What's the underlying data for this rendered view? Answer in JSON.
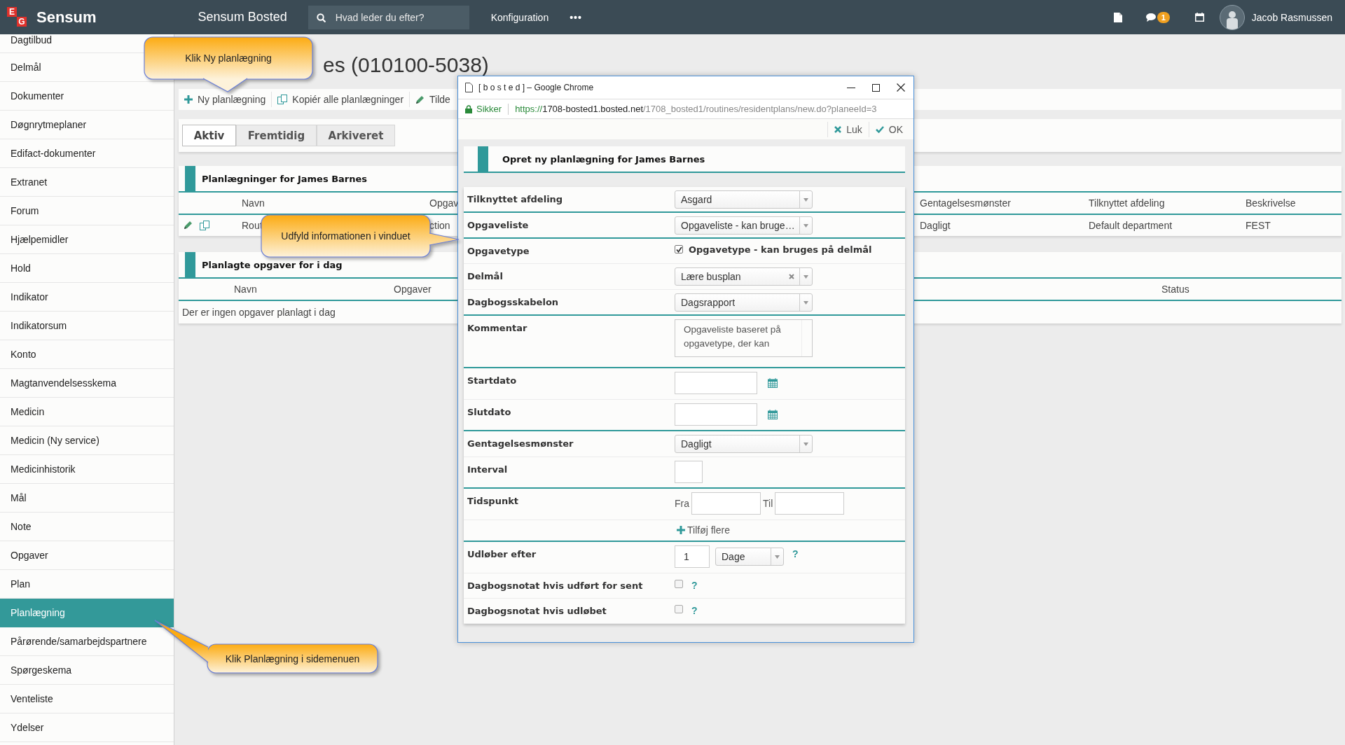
{
  "topbar": {
    "logo": [
      "E",
      "G"
    ],
    "brand": "Sensum",
    "app_name": "Sensum Bosted",
    "search": {
      "placeholder": "Hvad leder du efter?"
    },
    "menu": "Konfiguration",
    "more": "•••",
    "notifications": "1",
    "user": "Jacob Rasmussen"
  },
  "sidebar": {
    "items": [
      {
        "label": "Dagtilbud",
        "selected": false
      },
      {
        "label": "Delmål",
        "selected": false
      },
      {
        "label": "Dokumenter",
        "selected": false
      },
      {
        "label": "Døgnrytmeplaner",
        "selected": false
      },
      {
        "label": "Edifact-dokumenter",
        "selected": false
      },
      {
        "label": "Extranet",
        "selected": false
      },
      {
        "label": "Forum",
        "selected": false
      },
      {
        "label": "Hjælpemidler",
        "selected": false
      },
      {
        "label": "Hold",
        "selected": false
      },
      {
        "label": "Indikator",
        "selected": false
      },
      {
        "label": "Indikatorsum",
        "selected": false
      },
      {
        "label": "Konto",
        "selected": false
      },
      {
        "label": "Magtanvendelsesskema",
        "selected": false
      },
      {
        "label": "Medicin",
        "selected": false
      },
      {
        "label": "Medicin (Ny service)",
        "selected": false
      },
      {
        "label": "Medicinhistorik",
        "selected": false
      },
      {
        "label": "Mål",
        "selected": false
      },
      {
        "label": "Note",
        "selected": false
      },
      {
        "label": "Opgaver",
        "selected": false
      },
      {
        "label": "Plan",
        "selected": false
      },
      {
        "label": "Planlægning",
        "selected": true
      },
      {
        "label": "Pårørende/samarbejdspartnere",
        "selected": false
      },
      {
        "label": "Spørgeskema",
        "selected": false
      },
      {
        "label": "Venteliste",
        "selected": false
      },
      {
        "label": "Ydelser",
        "selected": false
      }
    ]
  },
  "page": {
    "title": "es (010100-5038)",
    "toolbar": [
      "Ny planlægning",
      "Kopiér alle planlægninger",
      "Tilde"
    ],
    "tabs": [
      {
        "label": "Aktiv",
        "selected": true
      },
      {
        "label": "Fremtidig",
        "selected": false
      },
      {
        "label": "Arkiveret",
        "selected": false
      }
    ],
    "plans": {
      "title": "Planlægninger for James Barnes",
      "columns": [
        "Navn",
        "Opgav",
        "Gentagelsesmønster",
        "Tilknyttet afdeling",
        "Beskrivelse"
      ],
      "rows": [
        {
          "cells": [
            "Rout",
            "ction",
            "Dagligt",
            "Default department",
            "FEST"
          ]
        }
      ]
    },
    "today": {
      "title": "Planlagte opgaver for i dag",
      "columns": [
        "Navn",
        "Opgaver",
        "Status"
      ],
      "empty": "Der er ingen opgaver planlagt i dag"
    }
  },
  "dialog": {
    "window_title": "[ b o s t e d ] – Google Chrome",
    "secure_label": "Sikker",
    "url": {
      "scheme": "https://",
      "host": "1708-bosted1.bosted.net",
      "path": "/1708_bosted1/routines/residentplans/new.do?planeeId=3"
    },
    "actions": [
      "Luk",
      "OK"
    ],
    "heading": "Opret ny planlægning for James Barnes",
    "fields": [
      {
        "kind": "select",
        "label": "Tilknyttet afdeling",
        "value": "Asgard",
        "group_end": true
      },
      {
        "kind": "select",
        "label": "Opgaveliste",
        "value": "Opgaveliste - kan bruge…",
        "group_end": true
      },
      {
        "kind": "checkbox",
        "label": "Opgavetype",
        "checked": true,
        "text": "Opgavetype - kan bruges på delmål",
        "group_end": false
      },
      {
        "kind": "select",
        "label": "Delmål",
        "value": "Lære busplan",
        "clearable": true,
        "group_end": false
      },
      {
        "kind": "select",
        "label": "Dagbogsskabelon",
        "value": "Dagsrapport",
        "group_end": true
      },
      {
        "kind": "textarea",
        "label": "Kommentar",
        "value": "Opgaveliste baseret på opgavetype, der kan",
        "group_end": true
      },
      {
        "kind": "date",
        "label": "Startdato",
        "group_end": false
      },
      {
        "kind": "date",
        "label": "Slutdato",
        "group_end": true
      },
      {
        "kind": "select",
        "label": "Gentagelsesmønster",
        "value": "Dagligt",
        "group_end": false
      },
      {
        "kind": "number",
        "label": "Interval",
        "group_end": true
      },
      {
        "kind": "timerange",
        "label": "Tidspunkt",
        "from_label": "Fra",
        "to_label": "Til",
        "group_end": false
      },
      {
        "kind": "add",
        "text": "Tilføj flere",
        "group_end": true
      },
      {
        "kind": "expiry",
        "label": "Udløber efter",
        "value": "1",
        "unit": "Dage",
        "help": "?",
        "group_end": false
      },
      {
        "kind": "checkbox",
        "label": "Dagbogsnotat hvis udført for sent",
        "checked": false,
        "help": "?",
        "group_end": false
      },
      {
        "kind": "checkbox",
        "label": "Dagbogsnotat hvis udløbet",
        "checked": false,
        "help": "?",
        "group_end": false
      }
    ]
  },
  "callouts": [
    {
      "text": "Klik Ny planlægning"
    },
    {
      "text": "Udfyld informationen i vinduet"
    },
    {
      "text": "Klik Planlægning i sidemenuen"
    }
  ]
}
